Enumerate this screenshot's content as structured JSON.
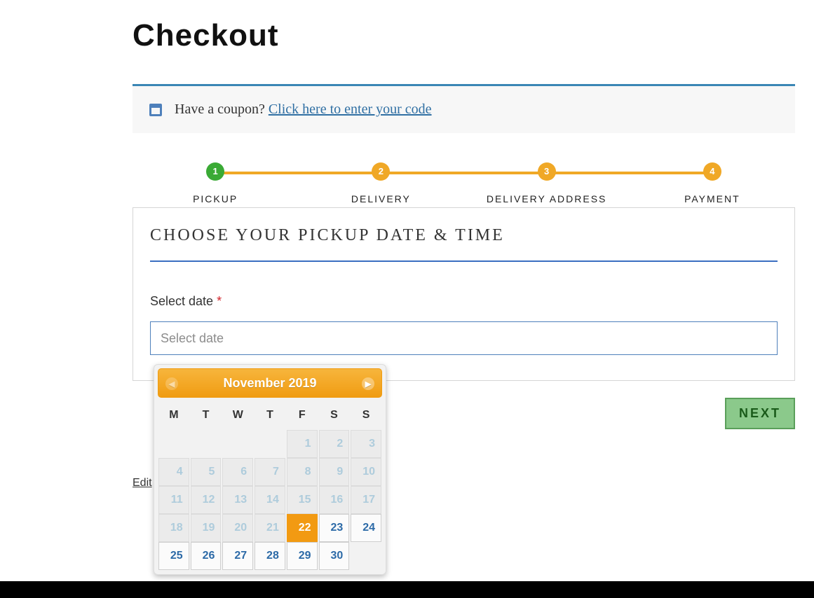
{
  "page": {
    "title": "Checkout"
  },
  "coupon": {
    "question": "Have a coupon? ",
    "link_text": "Click here to enter your code"
  },
  "stepper": {
    "steps": [
      {
        "num": "1",
        "label": "PICKUP"
      },
      {
        "num": "2",
        "label": "DELIVERY"
      },
      {
        "num": "3",
        "label": "DELIVERY ADDRESS"
      },
      {
        "num": "4",
        "label": "PAYMENT"
      }
    ]
  },
  "panel": {
    "title": "CHOOSE YOUR PICKUP DATE & TIME",
    "date_label": "Select date ",
    "date_required_mark": "*",
    "date_placeholder": "Select date"
  },
  "buttons": {
    "next": "NEXT"
  },
  "edit_link": "Edit",
  "datepicker": {
    "title": "November 2019",
    "prev_icon": "chevron-left-icon",
    "next_icon": "chevron-right-icon",
    "dow": [
      "M",
      "T",
      "W",
      "T",
      "F",
      "S",
      "S"
    ],
    "weeks": [
      [
        {
          "t": "blank"
        },
        {
          "t": "blank"
        },
        {
          "t": "blank"
        },
        {
          "t": "blank"
        },
        {
          "t": "past",
          "d": "1"
        },
        {
          "t": "past",
          "d": "2"
        },
        {
          "t": "past",
          "d": "3"
        }
      ],
      [
        {
          "t": "past",
          "d": "4"
        },
        {
          "t": "past",
          "d": "5"
        },
        {
          "t": "past",
          "d": "6"
        },
        {
          "t": "past",
          "d": "7"
        },
        {
          "t": "past",
          "d": "8"
        },
        {
          "t": "past",
          "d": "9"
        },
        {
          "t": "past",
          "d": "10"
        }
      ],
      [
        {
          "t": "past",
          "d": "11"
        },
        {
          "t": "past",
          "d": "12"
        },
        {
          "t": "past",
          "d": "13"
        },
        {
          "t": "past",
          "d": "14"
        },
        {
          "t": "past",
          "d": "15"
        },
        {
          "t": "past",
          "d": "16"
        },
        {
          "t": "past",
          "d": "17"
        }
      ],
      [
        {
          "t": "past",
          "d": "18"
        },
        {
          "t": "past",
          "d": "19"
        },
        {
          "t": "past",
          "d": "20"
        },
        {
          "t": "past",
          "d": "21"
        },
        {
          "t": "today",
          "d": "22"
        },
        {
          "t": "avail",
          "d": "23"
        },
        {
          "t": "avail",
          "d": "24"
        }
      ],
      [
        {
          "t": "avail",
          "d": "25"
        },
        {
          "t": "avail",
          "d": "26"
        },
        {
          "t": "avail",
          "d": "27"
        },
        {
          "t": "avail",
          "d": "28"
        },
        {
          "t": "avail",
          "d": "29"
        },
        {
          "t": "avail",
          "d": "30"
        },
        {
          "t": "blank"
        }
      ]
    ]
  }
}
